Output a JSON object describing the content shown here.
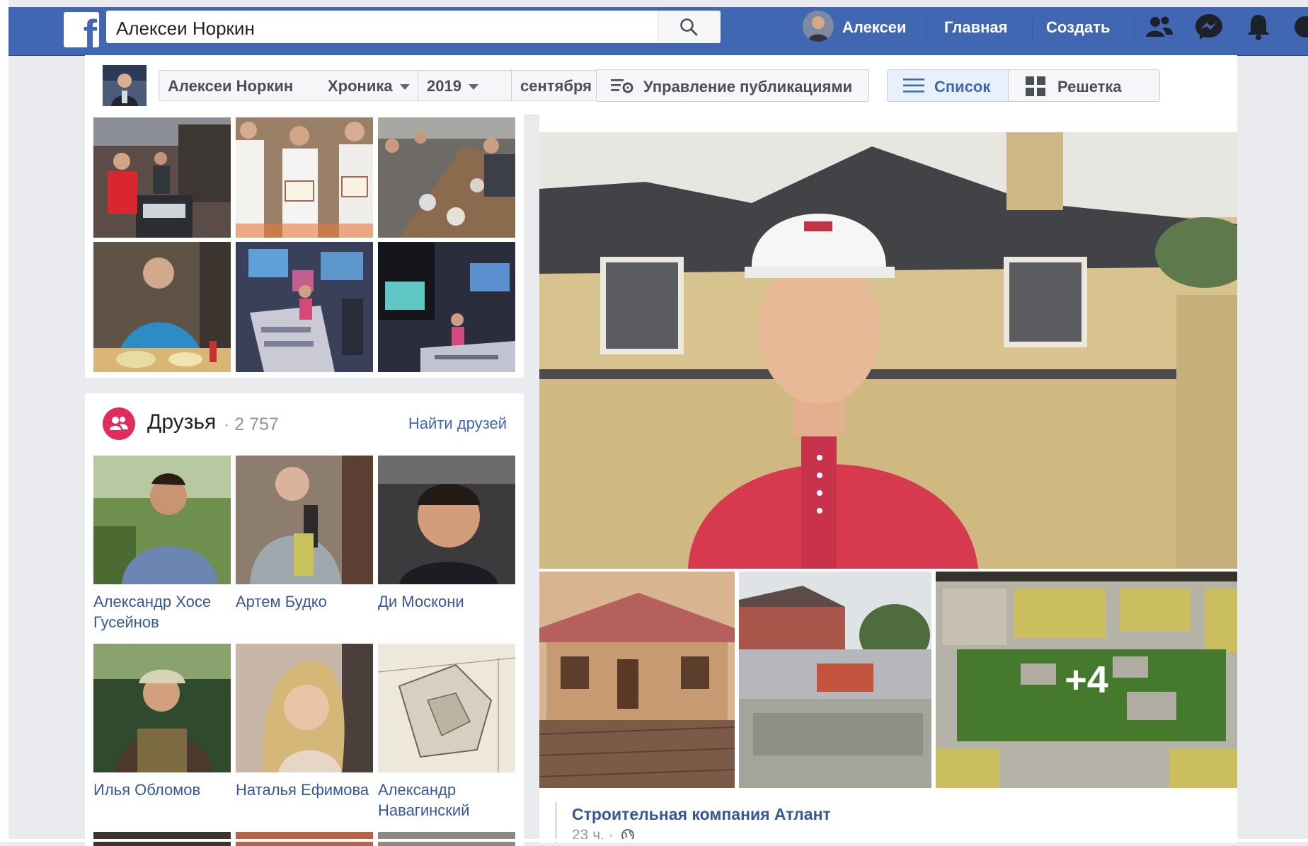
{
  "top_nav": {
    "logo": "f",
    "search_value": "Алексеи Норкин",
    "user_label": "Алексеи",
    "home_label": "Главная",
    "create_label": "Создать",
    "icons": [
      "friend-requests-icon",
      "messenger-icon",
      "notifications-icon"
    ]
  },
  "timeline_header": {
    "crumbs": [
      "Алексеи Норкин",
      "Хроника",
      "2019",
      "сентября"
    ],
    "manage_posts_label": "Управление публикациями",
    "view_list_label": "Список",
    "view_grid_label": "Решетка"
  },
  "friends": {
    "title": "Друзья",
    "count": "· 2 757",
    "find_label": "Найти друзей",
    "items": [
      {
        "name": "Александр Хосе Гусейнов"
      },
      {
        "name": "Артем Будко"
      },
      {
        "name": "Ди Москони"
      },
      {
        "name": "Илья Обломов"
      },
      {
        "name": "Наталья Ефимова"
      },
      {
        "name": "Александр Навагинский"
      }
    ]
  },
  "post": {
    "more_photos": "+4",
    "author": "Строительная компания Атлант",
    "time": "23 ч. ·"
  },
  "colors": {
    "brand_blue": "#4267b2",
    "link_blue": "#365899",
    "friends_icon": "#e12d5d",
    "page_bg": "#e9ebee"
  }
}
